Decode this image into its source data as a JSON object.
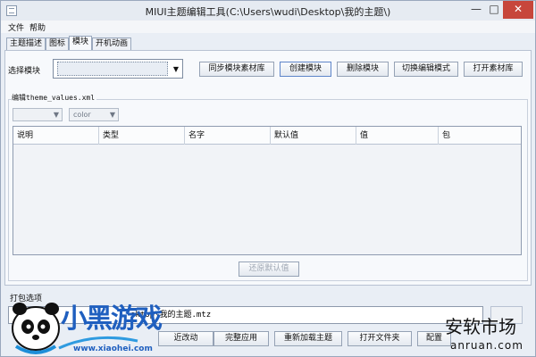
{
  "window": {
    "title": "MIUI主题编辑工具(C:\\Users\\wudi\\Desktop\\我的主题\\)",
    "min": "—",
    "max": "□",
    "close": "✕"
  },
  "menu": [
    "文件",
    "帮助"
  ],
  "tabs": [
    {
      "label": "主题描述",
      "active": false
    },
    {
      "label": "图标",
      "active": false
    },
    {
      "label": "模块",
      "active": true
    },
    {
      "label": "开机动画",
      "active": false
    }
  ],
  "module": {
    "select_label": "选择模块",
    "select_value": "",
    "buttons": [
      "同步模块素材库",
      "创建模块",
      "删除模块",
      "切换编辑模式",
      "打开素材库"
    ]
  },
  "editor": {
    "group_title": "编辑theme_values.xml",
    "filter1": "",
    "filter2": "color",
    "columns": [
      "说明",
      "类型",
      "名字",
      "默认值",
      "值",
      "包"
    ],
    "restore_button": "还原默认值"
  },
  "pack": {
    "label": "打包选项",
    "path": "sktop\\我的主题.mtz",
    "buttons": [
      "近改动",
      "完整应用",
      "重新加载主题",
      "打开文件夹",
      "配置"
    ]
  },
  "watermark_left": {
    "brand": "小黑游戏",
    "url": "www.xiaohei.com"
  },
  "watermark_right": {
    "brand": "安软市场",
    "url": "anruan.com"
  }
}
